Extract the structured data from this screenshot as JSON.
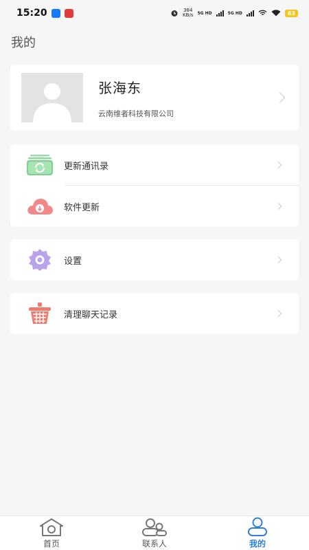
{
  "status_bar": {
    "time": "15:20",
    "speed_value": "384",
    "speed_unit": "KB/s",
    "network_1": "5G HD",
    "network_2": "5G HD",
    "battery": "63"
  },
  "page_title": "我的",
  "profile": {
    "name": "张海东",
    "company": "云南维者科技有限公司"
  },
  "menu": {
    "update_contacts": "更新通讯录",
    "software_update": "软件更新",
    "settings": "设置",
    "clear_chat": "清理聊天记录"
  },
  "tabs": [
    {
      "label": "首页",
      "icon": "home-icon"
    },
    {
      "label": "联系人",
      "icon": "contacts-icon"
    },
    {
      "label": "我的",
      "icon": "profile-icon",
      "active": true
    }
  ],
  "colors": {
    "accent": "#2f7fd6",
    "update_contacts_icon": "#7ed08f",
    "software_update_icon": "#f08a8a",
    "settings_icon": "#b9a3ea",
    "clear_chat_icon": "#f07a6e"
  }
}
